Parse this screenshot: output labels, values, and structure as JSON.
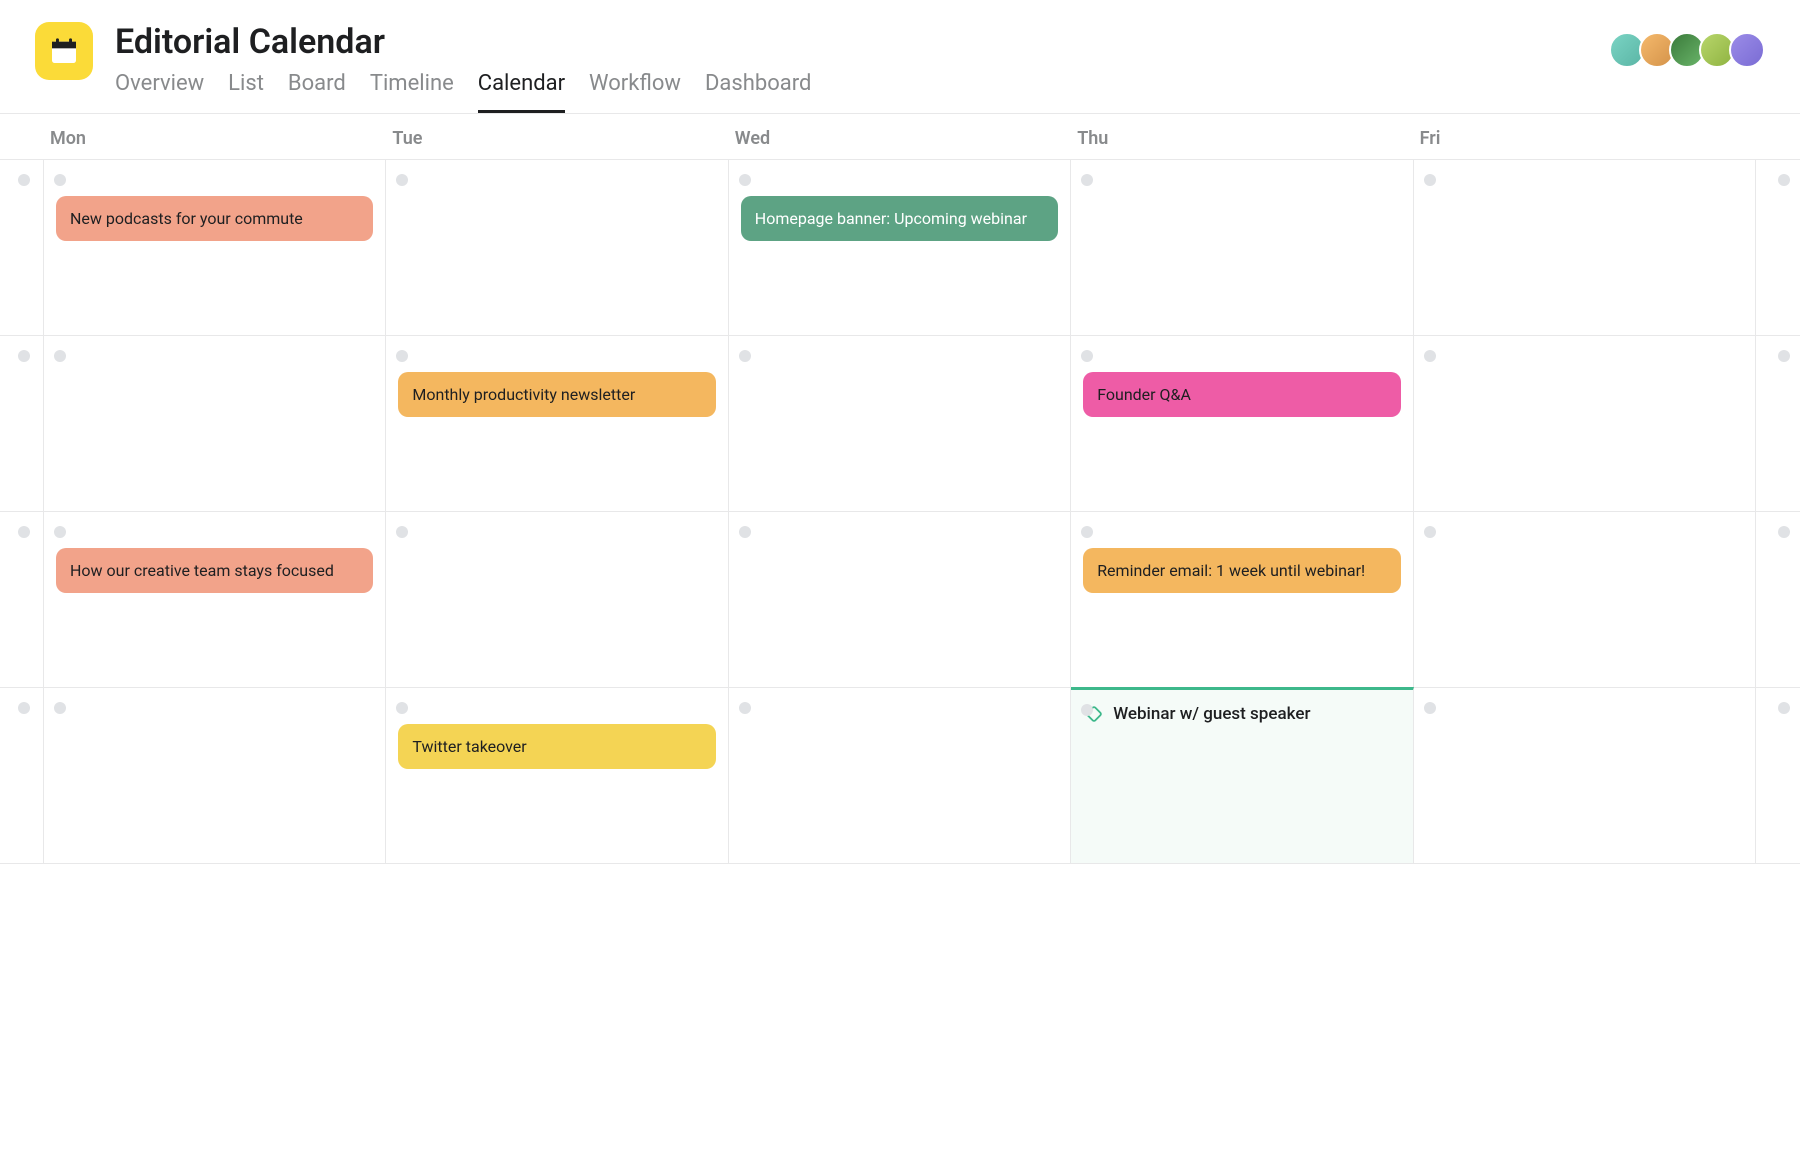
{
  "header": {
    "title": "Editorial Calendar"
  },
  "tabs": [
    {
      "id": "overview",
      "label": "Overview"
    },
    {
      "id": "list",
      "label": "List"
    },
    {
      "id": "board",
      "label": "Board"
    },
    {
      "id": "timeline",
      "label": "Timeline"
    },
    {
      "id": "calendar",
      "label": "Calendar",
      "active": true
    },
    {
      "id": "workflow",
      "label": "Workflow"
    },
    {
      "id": "dashboard",
      "label": "Dashboard"
    }
  ],
  "avatars": [
    {
      "name": "user-1"
    },
    {
      "name": "user-2"
    },
    {
      "name": "user-3"
    },
    {
      "name": "user-4"
    },
    {
      "name": "user-5"
    }
  ],
  "days": [
    "Mon",
    "Tue",
    "Wed",
    "Thu",
    "Fri"
  ],
  "tasks": {
    "w1_mon": {
      "label": "New podcasts for your commute",
      "color": "coral"
    },
    "w1_wed": {
      "label": "Homepage banner: Upcoming webinar",
      "color": "green"
    },
    "w2_tue": {
      "label": "Monthly productivity newsletter",
      "color": "orange"
    },
    "w2_thu": {
      "label": "Founder Q&A",
      "color": "pink"
    },
    "w3_mon": {
      "label": "How our creative team stays focused",
      "color": "coral"
    },
    "w3_thu": {
      "label": "Reminder email: 1 week until webinar!",
      "color": "orange"
    },
    "w4_tue": {
      "label": "Twitter takeover",
      "color": "yellow"
    },
    "w4_thu_inline": {
      "label": "Webinar w/ guest speaker"
    }
  },
  "colors": {
    "coral": "#f2a38a",
    "green": "#5da384",
    "orange": "#f4b75f",
    "pink": "#ee5ca6",
    "yellow": "#f4d454",
    "highlight": "#3db88b"
  }
}
